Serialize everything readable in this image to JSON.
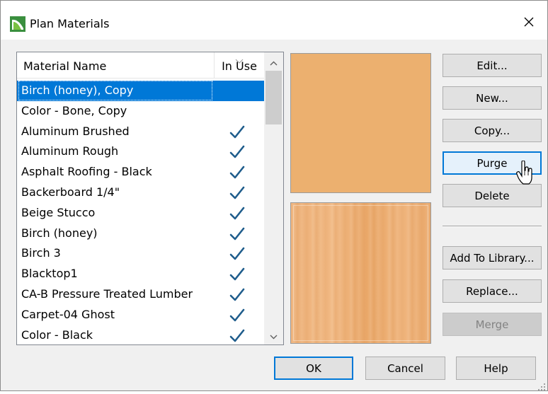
{
  "window": {
    "title": "Plan Materials",
    "icon": "chief-architect-app-icon",
    "close_icon": "close-icon"
  },
  "materials_list": {
    "columns": {
      "name": "Material Name",
      "in_use": "In Use"
    },
    "selected_index": 0,
    "rows": [
      {
        "name": "Birch (honey), Copy",
        "in_use": false
      },
      {
        "name": "Color - Bone, Copy",
        "in_use": false
      },
      {
        "name": "Aluminum Brushed",
        "in_use": true
      },
      {
        "name": "Aluminum Rough",
        "in_use": true
      },
      {
        "name": "Asphalt Roofing - Black",
        "in_use": true
      },
      {
        "name": "Backerboard 1/4\"",
        "in_use": true
      },
      {
        "name": "Beige Stucco",
        "in_use": true
      },
      {
        "name": "Birch (honey)",
        "in_use": true
      },
      {
        "name": "Birch 3",
        "in_use": true
      },
      {
        "name": "Blacktop1",
        "in_use": true
      },
      {
        "name": "CA-B Pressure Treated Lumber",
        "in_use": true
      },
      {
        "name": "Carpet-04 Ghost",
        "in_use": true
      },
      {
        "name": "Color - Black",
        "in_use": true
      }
    ]
  },
  "preview": {
    "color_hex": "#ecb06f",
    "texture": "birch-wood-grain"
  },
  "side_buttons": {
    "edit": "Edit...",
    "new": "New...",
    "copy": "Copy...",
    "purge": "Purge",
    "delete": "Delete",
    "add_to_library": "Add To Library...",
    "replace": "Replace...",
    "merge": "Merge"
  },
  "bottom_buttons": {
    "ok": "OK",
    "cancel": "Cancel",
    "help": "Help"
  },
  "colors": {
    "selection": "#0078d7",
    "check": "#1f5d8c",
    "focus_border": "#0078d7"
  }
}
